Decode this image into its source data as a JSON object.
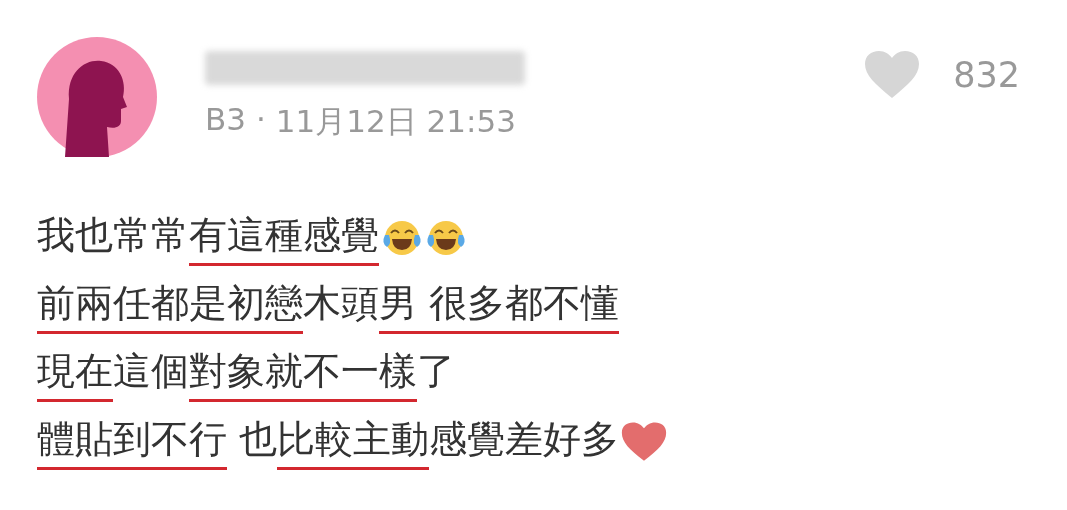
{
  "comment": {
    "floor": "B3",
    "separator": "·",
    "date": "11月12日 21:53",
    "likes": "832",
    "liked": false
  },
  "lines": [
    [
      {
        "kind": "text",
        "text": "我也常常",
        "underlined": false
      },
      {
        "kind": "text",
        "text": "有這種感覺",
        "underlined": true
      },
      {
        "kind": "laugh_emoji"
      },
      {
        "kind": "laugh_emoji"
      }
    ],
    [
      {
        "kind": "text",
        "text": "前兩任都是初戀",
        "underlined": true
      },
      {
        "kind": "text",
        "text": "木頭",
        "underlined": false
      },
      {
        "kind": "text",
        "text": "男 很多都不懂",
        "underlined": true
      }
    ],
    [
      {
        "kind": "text",
        "text": "現在",
        "underlined": true
      },
      {
        "kind": "text",
        "text": "這個",
        "underlined": false
      },
      {
        "kind": "text",
        "text": "對象就不一樣",
        "underlined": true
      },
      {
        "kind": "text",
        "text": "了",
        "underlined": false
      }
    ],
    [
      {
        "kind": "text",
        "text": "體貼到不行",
        "underlined": true
      },
      {
        "kind": "text",
        "text": " 也",
        "underlined": false
      },
      {
        "kind": "text",
        "text": "比較主動",
        "underlined": true
      },
      {
        "kind": "text",
        "text": "感覺差好多",
        "underlined": false
      },
      {
        "kind": "heart_emoji"
      }
    ]
  ]
}
